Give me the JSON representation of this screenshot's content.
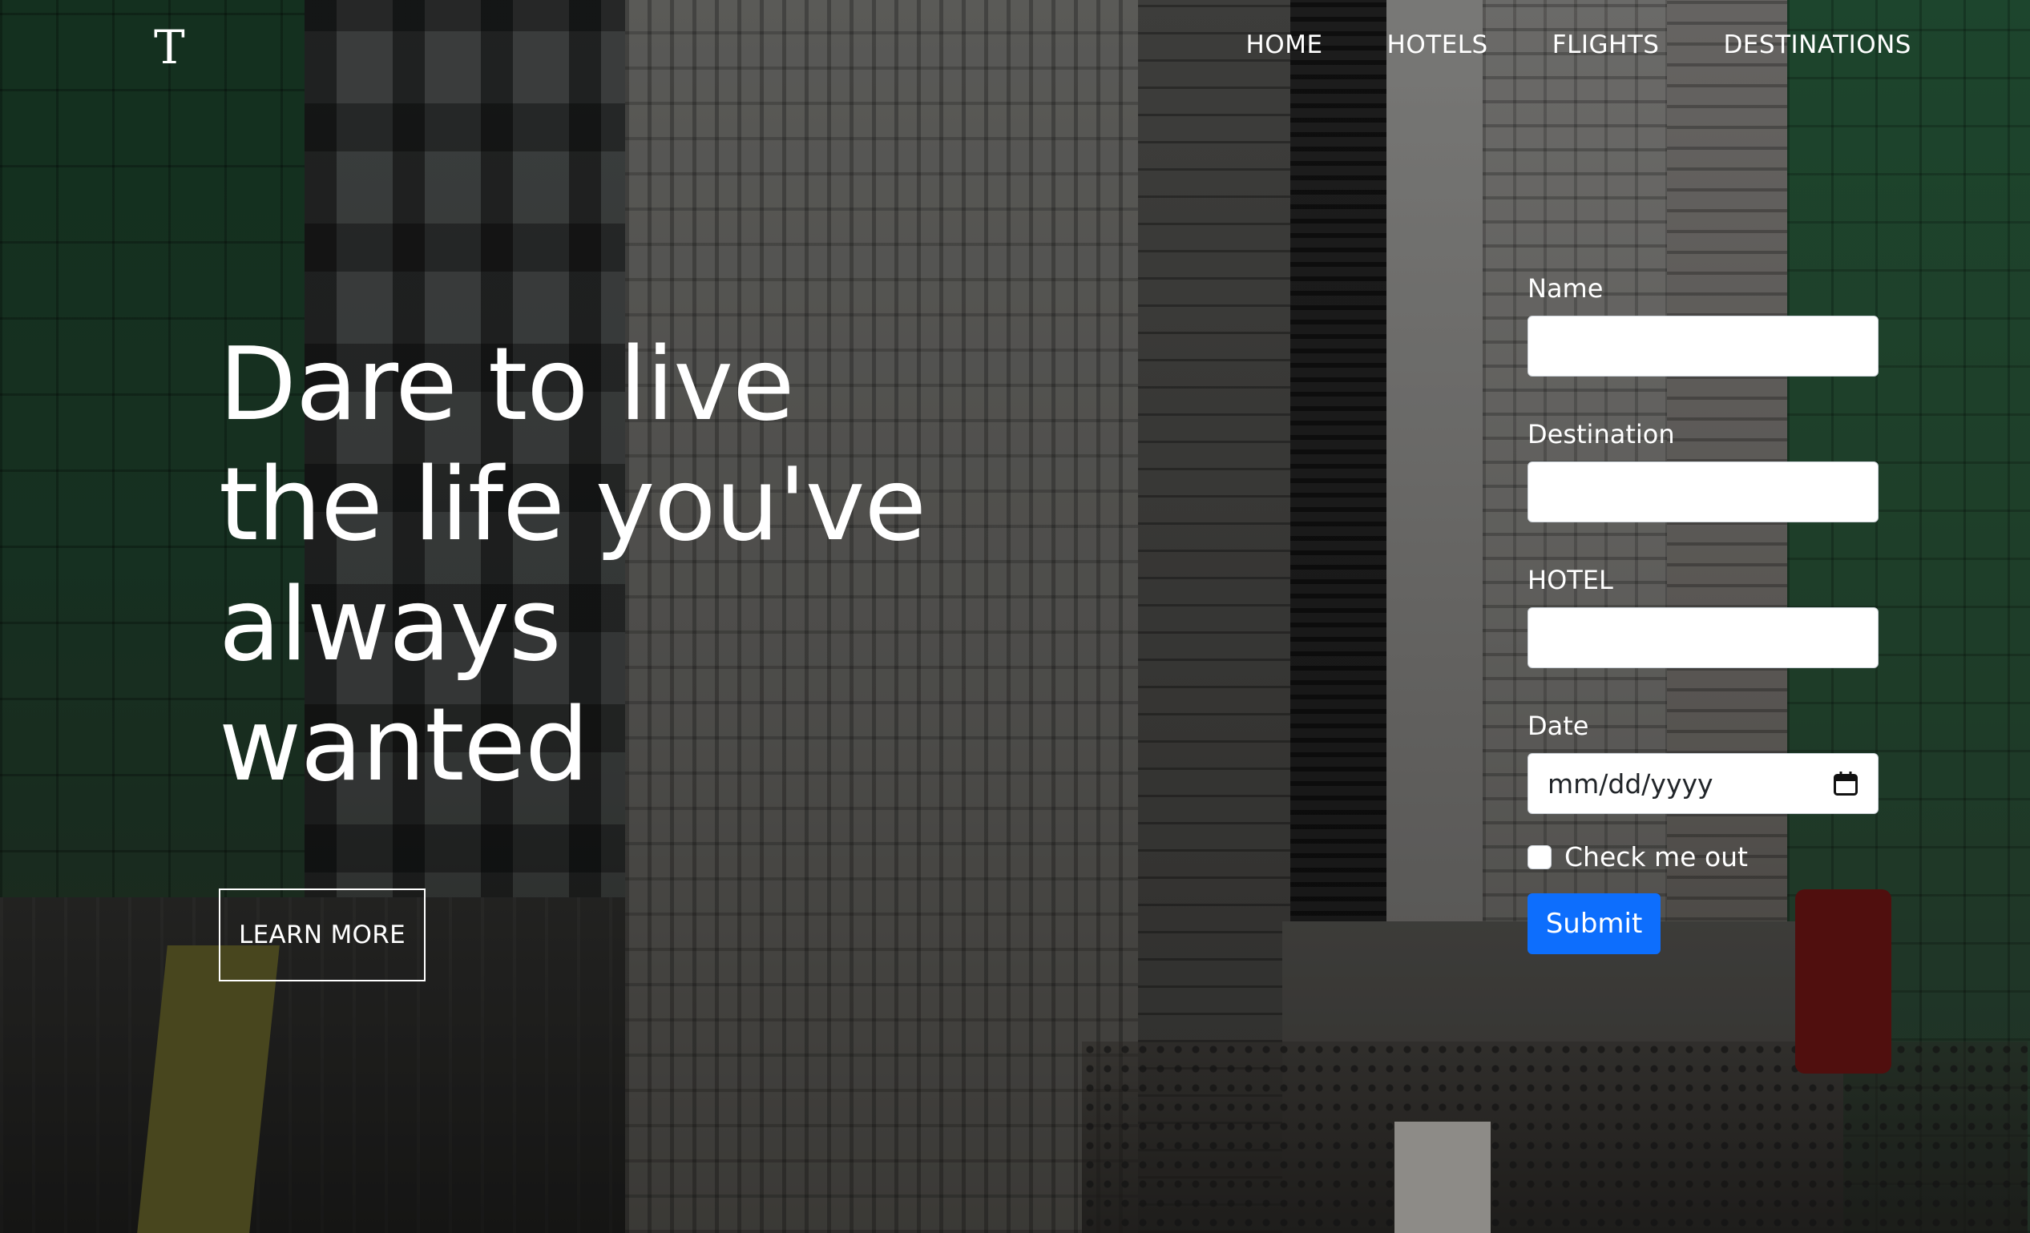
{
  "brand": {
    "logo_text": "T"
  },
  "nav": {
    "items": [
      {
        "label": "HOME"
      },
      {
        "label": "HOTELS"
      },
      {
        "label": "FLIGHTS"
      },
      {
        "label": "DESTINATIONS"
      }
    ]
  },
  "hero": {
    "title_lines": [
      "Dare to live",
      "the life you've",
      "always",
      "wanted"
    ],
    "cta_label": "LEARN MORE"
  },
  "form": {
    "name_label": "Name",
    "name_value": "",
    "destination_label": "Destination",
    "destination_value": "",
    "hotel_label": "HOTEL",
    "hotel_value": "",
    "date_label": "Date",
    "date_placeholder": "mm/dd/yyyy",
    "date_icon": "calendar-icon",
    "checkbox_label": "Check me out",
    "checkbox_checked": false,
    "submit_label": "Submit"
  },
  "colors": {
    "primary": "#0d6efd",
    "text": "#ffffff",
    "input_bg": "#ffffff"
  }
}
